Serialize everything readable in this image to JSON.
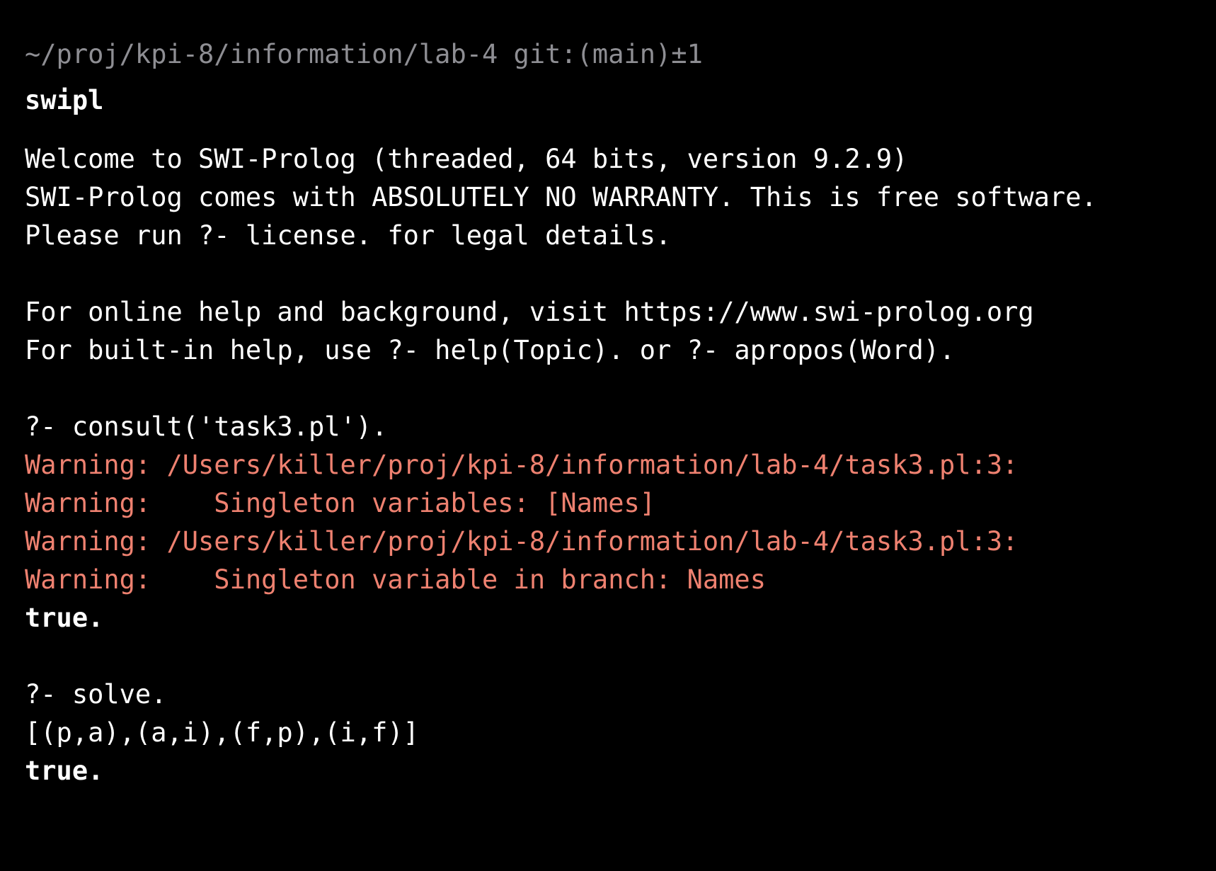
{
  "colors": {
    "background": "#000000",
    "text": "#ffffff",
    "muted": "#8e8e93",
    "warning": "#ee8170",
    "cursor": "#4ea3d9"
  },
  "shell": {
    "cwd_prompt": "~/proj/kpi-8/information/lab-4 git:(main)±1",
    "command": "swipl"
  },
  "banner": [
    "Welcome to SWI-Prolog (threaded, 64 bits, version 9.2.9)",
    "SWI-Prolog comes with ABSOLUTELY NO WARRANTY. This is free software.",
    "Please run ?- license. for legal details.",
    "",
    "For online help and background, visit https://www.swi-prolog.org",
    "For built-in help, use ?- help(Topic). or ?- apropos(Word)."
  ],
  "session": {
    "query1": "?- consult('task3.pl').",
    "warnings": [
      "Warning: /Users/killer/proj/kpi-8/information/lab-4/task3.pl:3:",
      "Warning:    Singleton variables: [Names]",
      "Warning: /Users/killer/proj/kpi-8/information/lab-4/task3.pl:3:",
      "Warning:    Singleton variable in branch: Names"
    ],
    "result1": "true.",
    "query2": "?- solve.",
    "output2": "[(p,a),(a,i),(f,p),(i,f)]",
    "result2": "true.",
    "input_prompt": "?-"
  }
}
